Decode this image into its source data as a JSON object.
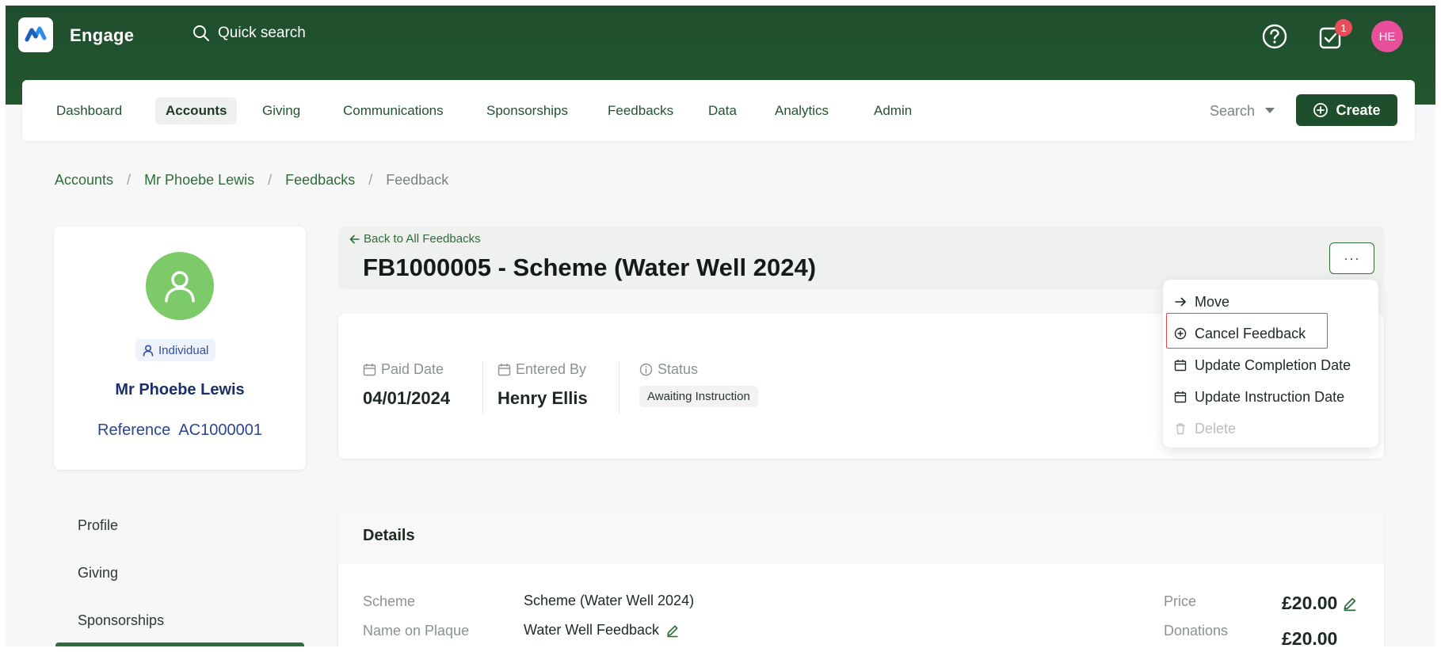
{
  "app": {
    "name": "Engage",
    "quick_search_placeholder": "Quick search",
    "tasks_badge": "1",
    "user_initials": "HE"
  },
  "nav": {
    "items": [
      {
        "label": "Dashboard",
        "active": false
      },
      {
        "label": "Accounts",
        "active": true
      },
      {
        "label": "Giving",
        "active": false
      },
      {
        "label": "Communications",
        "active": false
      },
      {
        "label": "Sponsorships",
        "active": false
      },
      {
        "label": "Feedbacks",
        "active": false
      },
      {
        "label": "Data",
        "active": false
      },
      {
        "label": "Analytics",
        "active": false
      },
      {
        "label": "Admin",
        "active": false
      }
    ],
    "search_label": "Search",
    "create_label": "Create"
  },
  "breadcrumb": [
    "Accounts",
    "Mr Phoebe Lewis",
    "Feedbacks",
    "Feedback"
  ],
  "profile": {
    "type": "Individual",
    "name": "Mr Phoebe Lewis",
    "reference_label": "Reference",
    "reference": "AC1000001"
  },
  "side_nav": [
    "Profile",
    "Giving",
    "Sponsorships"
  ],
  "header": {
    "back_label": "Back to All Feedbacks",
    "title": "FB1000005 - Scheme (Water Well 2024)",
    "more_label": "···"
  },
  "summary": {
    "paid_date": {
      "label": "Paid Date",
      "value": "04/01/2024"
    },
    "entered_by": {
      "label": "Entered By",
      "value": "Henry Ellis"
    },
    "status": {
      "label": "Status",
      "value": "Awaiting Instruction"
    }
  },
  "menu": {
    "items": [
      {
        "label": "Move",
        "icon": "arrow-right-icon",
        "disabled": false
      },
      {
        "label": "Cancel Feedback",
        "icon": "plus-circle-icon",
        "disabled": false
      },
      {
        "label": "Update Completion Date",
        "icon": "calendar-icon",
        "disabled": false
      },
      {
        "label": "Update Instruction Date",
        "icon": "calendar-icon",
        "disabled": false
      },
      {
        "label": "Delete",
        "icon": "trash-icon",
        "disabled": true
      }
    ],
    "highlighted": "Cancel Feedback"
  },
  "details": {
    "title": "Details",
    "scheme_label": "Scheme",
    "scheme_value": "Scheme (Water Well 2024)",
    "plaque_label": "Name on Plaque",
    "plaque_value": "Water Well Feedback",
    "price_label": "Price",
    "price_value": "£20.00",
    "donations_label": "Donations",
    "donations_value": "£20.00"
  },
  "colors": {
    "brand_dark": "#1f4e2d",
    "accent": "#2f6b3d",
    "badge": "#e84e5a",
    "avatar": "#e94e9a",
    "profile_avatar": "#7ccb68"
  }
}
